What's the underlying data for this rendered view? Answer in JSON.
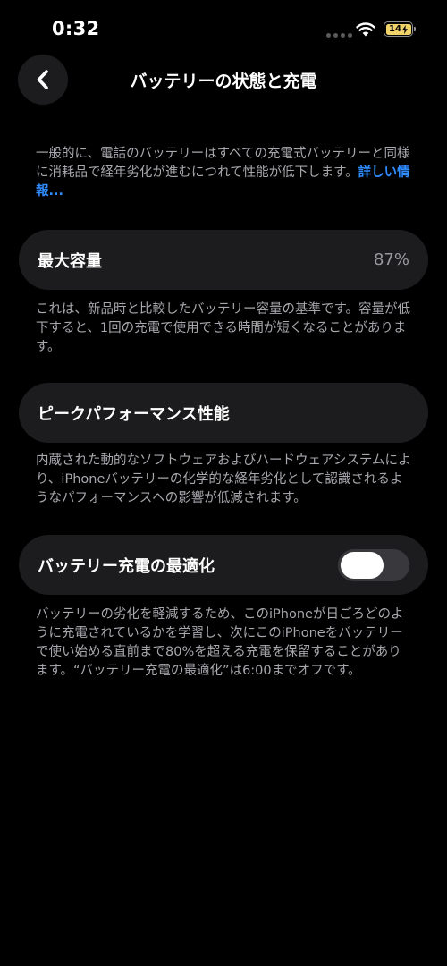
{
  "status_bar": {
    "time": "0:32",
    "battery_level": "14",
    "battery_color": "#f0d36a",
    "icons": [
      "signal-dots-icon",
      "wifi-icon",
      "battery-charging-icon"
    ]
  },
  "nav": {
    "back_icon": "chevron-left-icon",
    "title": "バッテリーの状態と充電"
  },
  "intro": {
    "text": "一般的に、電話のバッテリーはすべての充電式バッテリーと同様に消耗品で経年劣化が進むにつれて性能が低下します。",
    "link": "詳しい情報..."
  },
  "max_capacity": {
    "label": "最大容量",
    "value": "87%",
    "description": "これは、新品時と比較したバッテリー容量の基準です。容量が低下すると、1回の充電で使用できる時間が短くなることがあります。"
  },
  "peak_performance": {
    "label": "ピークパフォーマンス性能",
    "description": "内蔵された動的なソフトウェアおよびハードウェアシステムにより、iPhoneバッテリーの化学的な経年劣化として認識されるようなパフォーマンスへの影響が低減されます。"
  },
  "optimized_charging": {
    "label": "バッテリー充電の最適化",
    "toggle_state": "off",
    "description": "バッテリーの劣化を軽減するため、このiPhoneが日ごろどのように充電されているかを学習し、次にこのiPhoneをバッテリーで使い始める直前まで80%を超える充電を保留することがあります。“バッテリー充電の最適化”は6:00までオフです。"
  },
  "colors": {
    "background": "#000000",
    "card": "#1c1c1e",
    "link": "#2f8cff",
    "secondary_text": "#a7a7ad"
  }
}
